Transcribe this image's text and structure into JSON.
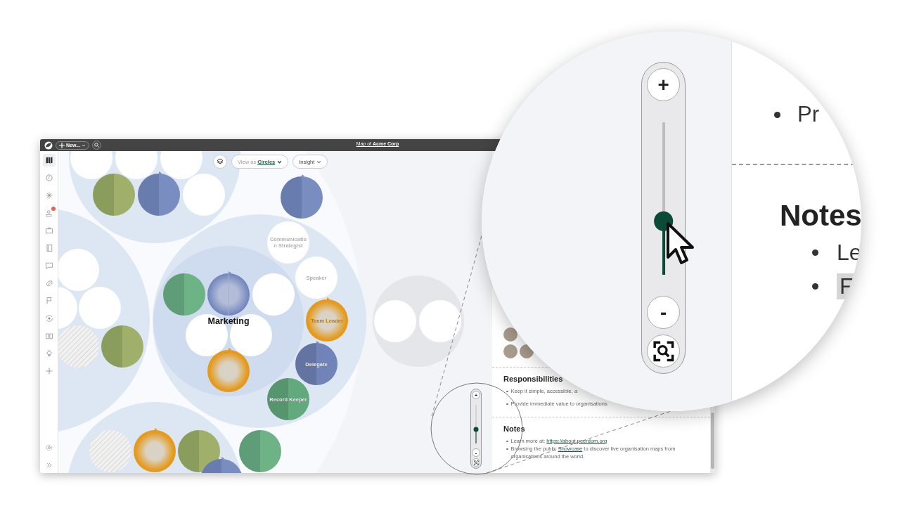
{
  "window": {
    "title": "Map of **Acme Corp**"
  },
  "toolbar": {
    "new_button": "New..."
  },
  "sidebar": {
    "items": [
      {
        "selected": true,
        "badge": false
      },
      {
        "selected": false,
        "badge": false
      },
      {
        "selected": false,
        "badge": false
      },
      {
        "selected": false,
        "badge": true
      },
      {
        "selected": false,
        "badge": false
      },
      {
        "selected": false,
        "badge": false
      },
      {
        "selected": false,
        "badge": false
      },
      {
        "selected": false,
        "badge": false
      },
      {
        "selected": false,
        "badge": false
      },
      {
        "selected": false,
        "badge": false
      },
      {
        "selected": false,
        "badge": false
      },
      {
        "selected": false,
        "badge": false
      },
      {
        "selected": false,
        "badge": false
      }
    ],
    "bottom_items": [
      {
        "selected": false
      },
      {
        "selected": false
      }
    ]
  },
  "map_controls": {
    "view_as": "View as **Circles**",
    "insight": "Insight"
  },
  "map": {
    "circle_title": "Marketing",
    "roles": [
      {
        "label": "Communication Strategist",
        "kind": "plain",
        "color": "#ffffff"
      },
      {
        "label": "Speaker",
        "kind": "plain",
        "color": "#ffffff"
      },
      {
        "label": "Team Leader",
        "kind": "glass",
        "color": "#e59a1c"
      },
      {
        "label": "Delegate",
        "kind": "split",
        "color": "#7084b9"
      },
      {
        "label": "Record Keeper",
        "kind": "split",
        "color": "#63a97e"
      }
    ],
    "zoom": {
      "plus": "+",
      "minus": "-",
      "level": 0.35
    }
  },
  "panel": {
    "responsibilities": {
      "heading": "Responsibilities",
      "items": [
        "Keep it simple, accessible, a",
        "Provide immediate value to organisations"
      ]
    },
    "notes": {
      "heading": "Notes",
      "items": [
        {
          "before": "Learn more at: ",
          "link": "https://about.peerdom.org"
        },
        {
          "before": "Browsing the public ",
          "link": "Showcase",
          "after": " to discover live organisation maps from organisations around the world."
        }
      ]
    }
  },
  "magnifier": {
    "partial_bullet": "Pr",
    "heading": "Notes",
    "bullets": [
      {
        "text": "Le",
        "highlighted": false
      },
      {
        "text": "F",
        "highlighted": true
      }
    ],
    "zoom": {
      "plus": "+",
      "minus": "-",
      "level": 0.35
    }
  }
}
